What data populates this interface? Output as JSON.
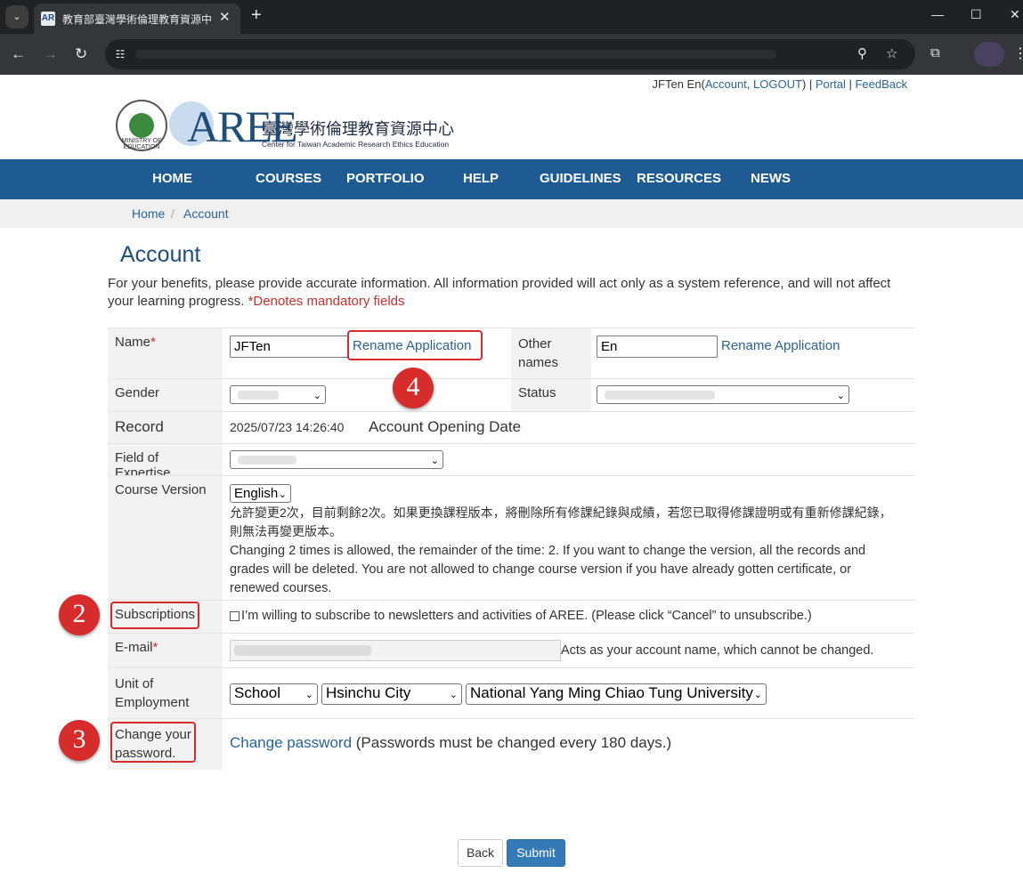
{
  "browser": {
    "tab_title": "教育部臺灣學術倫理教育資源中",
    "tab_favicon": "AR",
    "new_tab": "+",
    "tab_menu": "⌄"
  },
  "header": {
    "user_name": "JFTen En",
    "account": "Account",
    "logout": "LOGOUT",
    "portal": "Portal",
    "feedback": "FeedBack",
    "logo_word": "AREE",
    "logo_zh": "臺灣學術倫理教育資源中心",
    "logo_en": "Center for Taiwan Academic Research Ethics Education",
    "moe_text": "MINISTRY OF EDUCATION"
  },
  "nav": [
    "HOME",
    "COURSES",
    "PORTFOLIO",
    "HELP",
    "GUIDELINES",
    "RESOURCES",
    "NEWS"
  ],
  "breadcrumb": {
    "home": "Home",
    "sep": "/",
    "current": "Account"
  },
  "page": {
    "title": "Account",
    "intro": "For your benefits, please provide accurate information. All information provided will act only as a system reference, and will not affect your learning progress. ",
    "mandatory": "*Denotes mandatory fields"
  },
  "form": {
    "name_label": "Name",
    "req_mark": "*",
    "name_value": "JFTen",
    "rename": "Rename Application",
    "other_names_label": "Other names",
    "other_names_value": "En",
    "gender_label": "Gender",
    "status_label": "Status",
    "record_label": "Record",
    "record_date": "2025/07/23 14:26:40",
    "record_desc": "Account Opening Date",
    "expertise_label": "Field of Expertise",
    "course_label": "Course Version",
    "course_value": "English",
    "course_note_zh": "允許變更2次，目前剩餘2次。如果更換課程版本，將刪除所有修課紀錄與成績，若您已取得修課證明或有重新修課紀錄，則無法再變更版本。",
    "course_note_en": "Changing 2 times is allowed, the remainder of the time: 2. If you want to change the version, all the records and grades will be deleted. You are not allowed to change course version if you have already gotten certificate, or renewed courses.",
    "subs_label": "Subscriptions",
    "subs_text": "I’m willing to subscribe to newsletters and activities of AREE. (Please click “Cancel” to unsubscribe.)",
    "email_label": "E-mail",
    "email_note": "Acts as your account name, which cannot be changed.",
    "unit_label": "Unit of Employment",
    "unit_type": "School",
    "unit_city": "Hsinchu City",
    "unit_school": "National Yang Ming Chiao Tung University",
    "pw_label": "Change your password.",
    "pw_link": "Change password",
    "pw_note": "(Passwords must be changed every 180 days.)"
  },
  "annotations": [
    "4",
    "2",
    "3"
  ],
  "buttons": {
    "back": "Back",
    "submit": "Submit"
  },
  "colors": {
    "nav_bg": "#1f5b93",
    "link": "#2a6496",
    "annotation": "#d62c2c",
    "submit": "#337ab7"
  }
}
